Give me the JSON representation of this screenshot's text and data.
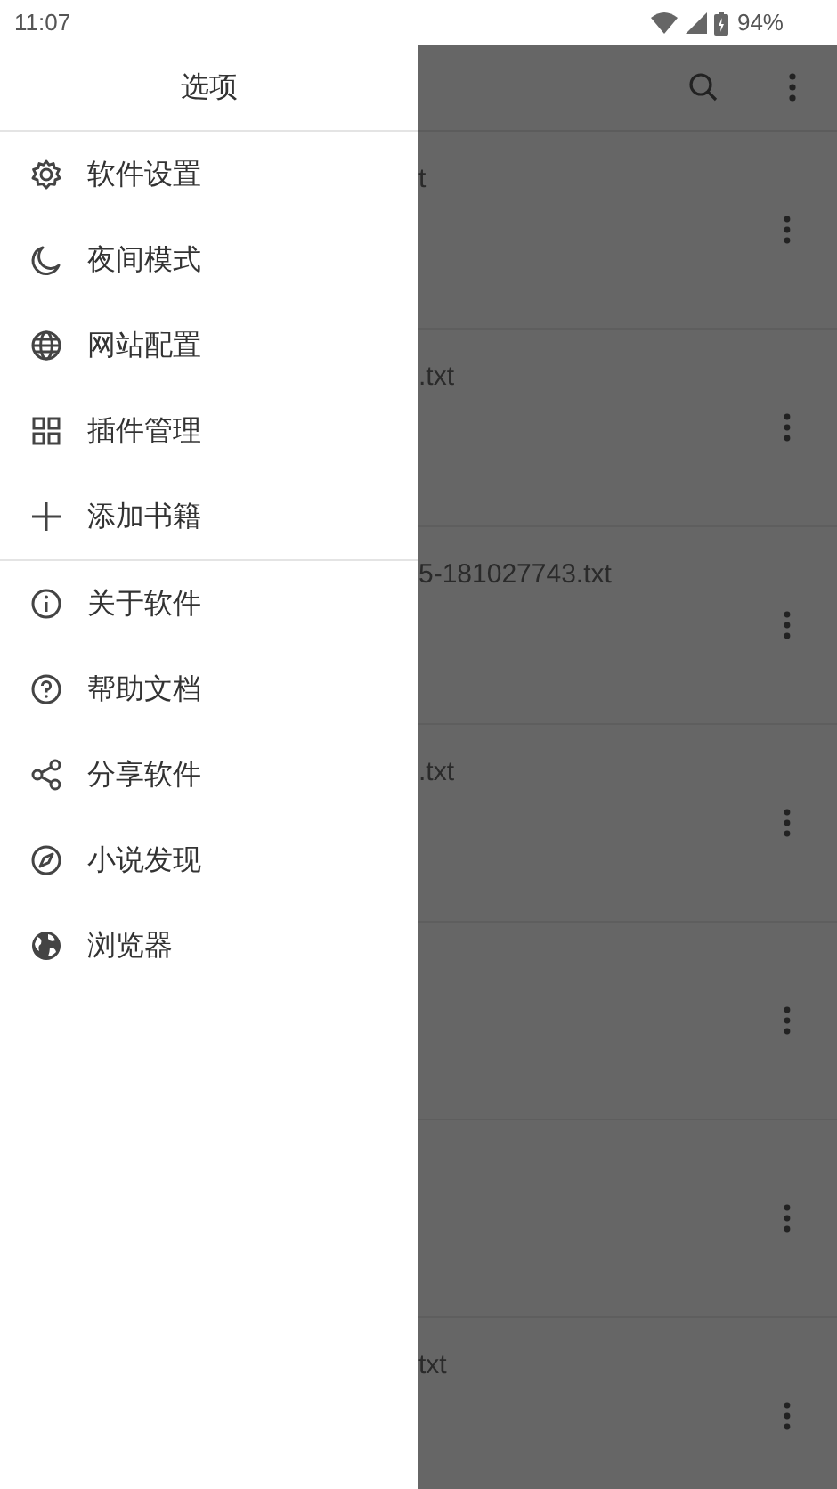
{
  "status_bar": {
    "time": "11:07",
    "battery": "94%"
  },
  "drawer": {
    "title": "选项",
    "sections": [
      {
        "items": [
          {
            "label": "软件设置"
          },
          {
            "label": "夜间模式"
          },
          {
            "label": "网站配置"
          },
          {
            "label": "插件管理"
          },
          {
            "label": "添加书籍"
          }
        ]
      },
      {
        "items": [
          {
            "label": "关于软件"
          },
          {
            "label": "帮助文档"
          },
          {
            "label": "分享软件"
          },
          {
            "label": "小说发现"
          },
          {
            "label": "浏览器"
          }
        ]
      }
    ]
  },
  "book_list": {
    "rows": [
      {
        "title": "t"
      },
      {
        "title": ".txt"
      },
      {
        "title": "5-181027743.txt"
      },
      {
        "title": ".txt"
      },
      {},
      {},
      {
        "title": "txt"
      }
    ]
  }
}
